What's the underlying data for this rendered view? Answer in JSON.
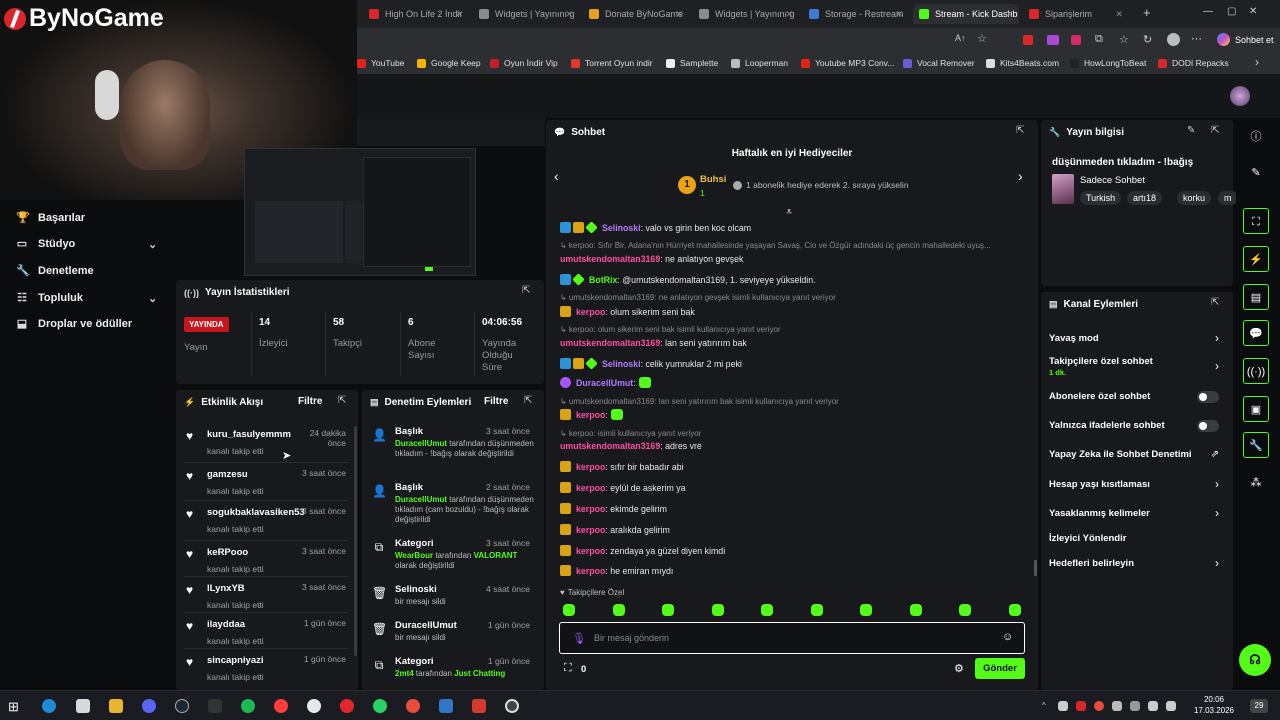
{
  "overlay": {
    "logo_text": "ByNoGame"
  },
  "browser": {
    "tabs": [
      {
        "label": "High On Life 2 İndir",
        "color": "#d8262b",
        "active": false
      },
      {
        "label": "Widgets | Yayınını g",
        "color": "#8a8a8a",
        "active": false
      },
      {
        "label": "Donate ByNoGame",
        "color": "#e6a11a",
        "active": false
      },
      {
        "label": "Widgets | Yayınını g",
        "color": "#8a8a8a",
        "active": false
      },
      {
        "label": "Storage - Restream",
        "color": "#3a7bd5",
        "active": false
      },
      {
        "label": "Stream - Kick Dashb",
        "color": "#53fc18",
        "active": true
      },
      {
        "label": "Siparişlerim",
        "color": "#d8262b",
        "active": false
      }
    ],
    "chat_button": "Sohbet et",
    "bookmarks": [
      {
        "label": "YouTube",
        "color": "#e62117"
      },
      {
        "label": "Google Keep",
        "color": "#f4b400"
      },
      {
        "label": "Oyun İndir Vip",
        "color": "#c21f2a"
      },
      {
        "label": "Torrent Oyun indir",
        "color": "#e3372a"
      },
      {
        "label": "Samplette",
        "color": "#eeeeee"
      },
      {
        "label": "Looperman",
        "color": "#bbbbbb"
      },
      {
        "label": "Youtube MP3 Conv...",
        "color": "#e62117"
      },
      {
        "label": "Vocal Remover",
        "color": "#6b5bd6"
      },
      {
        "label": "Kits4Beats.com",
        "color": "#dddddd"
      },
      {
        "label": "HowLongToBeat",
        "color": "#222222"
      },
      {
        "label": "DODI Repacks",
        "color": "#d8262b"
      }
    ]
  },
  "sidebar": {
    "items": [
      {
        "label": "Başarılar",
        "icon": "trophy-icon",
        "chevron": false
      },
      {
        "label": "Stüdyo",
        "icon": "studio-icon",
        "chevron": true
      },
      {
        "label": "Denetleme",
        "icon": "wrench-icon",
        "chevron": false
      },
      {
        "label": "Topluluk",
        "icon": "community-icon",
        "chevron": true
      },
      {
        "label": "Droplar ve ödüller",
        "icon": "gift-icon",
        "chevron": false
      }
    ]
  },
  "stats": {
    "title": "Yayın İstatistikleri",
    "live_badge": "YAYINDA",
    "live_label": "Yayın",
    "viewers": "14",
    "viewers_label": "İzleyici",
    "followers": "58",
    "followers_label": "Takipçi",
    "subs": "6",
    "subs_label": "Abone Sayısı",
    "uptime": "04:06:56",
    "uptime_label": "Yayında Olduğu Süre"
  },
  "activity": {
    "title": "Etkinlik Akışı",
    "filter": "Filtre",
    "items": [
      {
        "name": "kuru_fasulyemmm",
        "action": "kanalı takip etti",
        "time": "24 dakika önce"
      },
      {
        "name": "gamzesu",
        "action": "kanalı takip etti",
        "time": "3 saat önce"
      },
      {
        "name": "sogukbaklavasiken53",
        "action": "kanalı takip etti",
        "time": "3 saat önce"
      },
      {
        "name": "keRPooo",
        "action": "kanalı takip etti",
        "time": "3 saat önce"
      },
      {
        "name": "lLynxYB",
        "action": "kanalı takip etti",
        "time": "3 saat önce"
      },
      {
        "name": "ilayddaa",
        "action": "kanalı takip etti",
        "time": "1 gün önce"
      },
      {
        "name": "sincapniyazi",
        "action": "kanalı takip etti",
        "time": "1 gün önce"
      }
    ]
  },
  "moderation": {
    "title": "Denetim Eylemleri",
    "filter": "Filtre",
    "items": [
      {
        "title": "Başlık",
        "time": "3 saat önce",
        "user": "DuracellUmut",
        "pre": "tarafından",
        "detail": "düşünmeden tıkladım - !bağış",
        "post": "olarak değiştirildi",
        "icon": "user-edit-icon"
      },
      {
        "title": "Başlık",
        "time": "2 saat önce",
        "user": "DuracellUmut",
        "pre": "tarafından",
        "detail": "düşünmeden tıkladım (cam bozuldu) - !bağış",
        "post": "olarak değiştirildi",
        "icon": "user-edit-icon"
      },
      {
        "title": "Kategori",
        "time": "3 saat önce",
        "user": "WearBour",
        "pre": "tarafından",
        "detail": "VALORANT",
        "post": "olarak değiştirildi",
        "icon": "category-icon"
      },
      {
        "title": "Selinoski",
        "time": "4 saat önce",
        "desc": "bir mesajı sildi",
        "icon": "trash-icon"
      },
      {
        "title": "DuracellUmut",
        "time": "1 gün önce",
        "desc": "bir mesajı sildi",
        "icon": "trash-icon"
      },
      {
        "title": "Kategori",
        "time": "1 gün önce",
        "user": "2mt4",
        "pre": "tarafından",
        "detail": "Just Chatting",
        "post": "",
        "icon": "category-icon"
      }
    ]
  },
  "chat": {
    "title": "Sohbet",
    "gifters_title": "Haftalık en iyi Hediyeciler",
    "top_gifter": "Buhsi",
    "top_gifter_rank": "1",
    "top_gifter_count": "1",
    "gift_prompt": "1 abonelik hediye ederek 2. sıraya yükselin",
    "followers_only_label": "Takipçilere Özel",
    "input_placeholder": "Bir mesaj gönderin",
    "points": "0",
    "send_label": "Gönder",
    "messages": [
      {
        "user": "Selinoski",
        "text": ": valo vs girin ben koc olcam",
        "color": "u-violet",
        "badges": [
          "b-blue",
          "b-gold",
          "b-green"
        ]
      },
      {
        "reply": "↳ kerpoo: Sıfır Bir, Adana'nın Hürriyet mahallesinde yaşayan Savaş, Cio ve Özgür adındaki üç gencin mahalledeki uyuş..."
      },
      {
        "user": "umutskendomaltan3169",
        "text": ": ne anlatıyon gevşek",
        "color": "u-pink",
        "badges": []
      },
      {
        "user": "BotRix",
        "text": ": @umutskendomaltan3169, 1. seviyeye yükseldin.",
        "color": "u-green",
        "badges": [
          "b-blue",
          "b-green"
        ]
      },
      {
        "reply": "↳ umutskendomaltan3169: ne anlatıyon gevşek isimli kullanıcıya yanıt veriyor"
      },
      {
        "user": "kerpoo",
        "text": ": olum sikerim seni bak",
        "color": "u-pink",
        "badges": [
          "b-gold"
        ]
      },
      {
        "reply": "↳ kerpoo: olum sikerim seni bak isimli kullanıcıya yanıt veriyor"
      },
      {
        "user": "umutskendomaltan3169",
        "text": ": lan seni yatırırım bak",
        "color": "u-pink",
        "badges": []
      },
      {
        "user": "Selinoski",
        "text": ": celik yumruklar 2 mi peki",
        "color": "u-violet",
        "badges": [
          "b-blue",
          "b-gold",
          "b-green"
        ]
      },
      {
        "user": "DuracellUmut",
        "text": ":",
        "color": "u-violet",
        "badges": [
          "b-purple"
        ],
        "emote": true
      },
      {
        "reply": "↳ umutskendomaltan3169: lan seni yatırırım bak isimli kullanıcıya yanıt veriyor"
      },
      {
        "user": "kerpoo",
        "text": ":",
        "color": "u-pink",
        "badges": [
          "b-gold"
        ],
        "emote": true
      },
      {
        "reply": "↳ kerpoo:       isimli kullanıcıya yanıt veriyor"
      },
      {
        "user": "umutskendomaltan3169",
        "text": ": adres vre",
        "color": "u-pink",
        "badges": []
      },
      {
        "user": "kerpoo",
        "text": ": sıfır bir babadır abi",
        "color": "u-pink",
        "badges": [
          "b-gold"
        ]
      },
      {
        "user": "kerpoo",
        "text": ": eylül de askerim ya",
        "color": "u-pink",
        "badges": [
          "b-gold"
        ]
      },
      {
        "user": "kerpoo",
        "text": ": ekimde gelirim",
        "color": "u-pink",
        "badges": [
          "b-gold"
        ]
      },
      {
        "user": "kerpoo",
        "text": ": aralıkda gelirim",
        "color": "u-pink",
        "badges": [
          "b-gold"
        ]
      },
      {
        "user": "kerpoo",
        "text": ": zendaya ya güzel diyen kimdi",
        "color": "u-pink",
        "badges": [
          "b-gold"
        ]
      },
      {
        "user": "kerpoo",
        "text": ": he emiran mıydı",
        "color": "u-pink",
        "badges": [
          "b-gold"
        ]
      }
    ]
  },
  "stream_info": {
    "title": "Yayın bilgisi",
    "stream_title": "düşünmeden tıkladım - !bağış",
    "category": "Sadece Sohbet",
    "tags": [
      "Turkish",
      "artı18",
      "korku",
      "m"
    ]
  },
  "channel_actions": {
    "title": "Kanal Eylemleri",
    "items": [
      {
        "label": "Yavaş mod",
        "control": "chevron"
      },
      {
        "label": "Takipçilere özel sohbet",
        "sub": "1 dk.",
        "control": "chevron"
      },
      {
        "label": "Abonelere özel sohbet",
        "control": "toggle"
      },
      {
        "label": "Yalnızca ifadelerle sohbet",
        "control": "toggle"
      },
      {
        "label": "Yapay Zeka ile Sohbet Denetimi",
        "control": "external"
      },
      {
        "label": "Hesap yaşı kısıtlaması",
        "control": "chevron"
      },
      {
        "label": "Yasaklanmış kelimeler",
        "control": "chevron"
      },
      {
        "label": "İzleyici Yönlendir",
        "control": "none"
      },
      {
        "label": "Hedefleri belirleyin",
        "control": "chevron"
      }
    ]
  },
  "taskbar": {
    "time": "20:06",
    "date": "17.03.2026",
    "notifications": "29"
  },
  "colors": {
    "accent": "#53fc18",
    "live": "#c8161d"
  }
}
